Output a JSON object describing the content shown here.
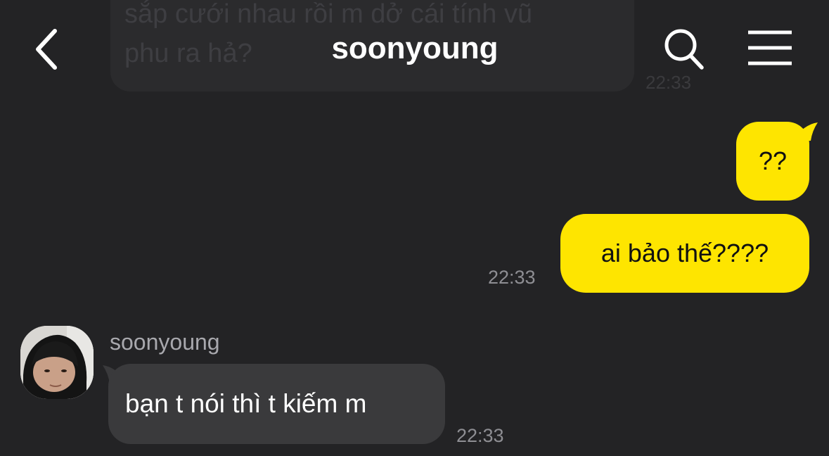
{
  "header": {
    "title": "soonyoung",
    "back_icon": "chevron-left-icon",
    "search_icon": "search-icon",
    "menu_icon": "hamburger-menu-icon"
  },
  "previous_message": {
    "text": "sắp cưới nhau rồi m dở cái tính vũ\nphu ra hả?",
    "time": "22:33"
  },
  "messages": [
    {
      "from": "me",
      "text": "??"
    },
    {
      "from": "me",
      "text": "ai bảo thế????",
      "time": "22:33"
    },
    {
      "from": "soonyoung",
      "sender": "soonyoung",
      "text": "bạn t nói thì t kiếm m",
      "time": "22:33"
    }
  ],
  "colors": {
    "background": "#232325",
    "sent_bubble": "#fee500",
    "received_bubble": "#3a3a3c",
    "timestamp": "#8e8e93"
  }
}
